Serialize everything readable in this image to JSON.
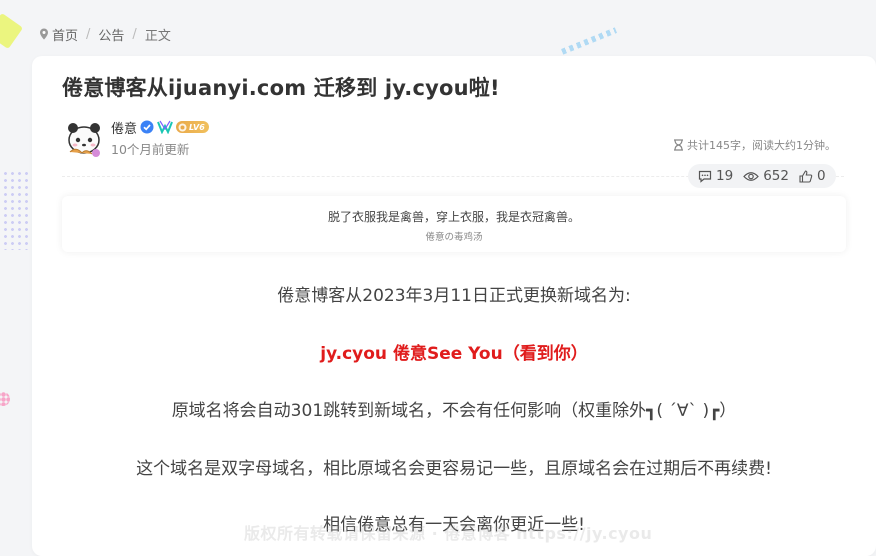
{
  "breadcrumb": {
    "items": [
      "首页",
      "公告",
      "正文"
    ],
    "separator": "/"
  },
  "post": {
    "title": "倦意博客从ijuanyi.com 迁移到 jy.cyou啦!",
    "author": {
      "name": "倦意",
      "level_badge": "LV6",
      "icons": [
        "verified-icon",
        "vip-icon"
      ],
      "updated": "10个月前更新"
    },
    "meta": "共计145字，阅读大约1分钟。",
    "stats": {
      "comments": "19",
      "views": "652",
      "likes": "0"
    },
    "quote": {
      "text": "脱了衣服我是禽兽，穿上衣服，我是衣冠禽兽。",
      "source": "倦意の毒鸡汤"
    },
    "paragraphs": [
      "倦意博客从2023年3月11日正式更换新域名为:",
      "jy.cyou   倦意See You（看到你）",
      "原域名将会自动301跳转到新域名，不会有任何影响（权重除外┓( ´∀` )┏）",
      "这个域名是双字母域名，相比原域名会更容易记一些，且原域名会在过期后不再续费!",
      "相信倦意总有一天会离你更近一些!"
    ],
    "watermark": "版权所有转载请保留来源 · 倦意博客 https://jy.cyou"
  },
  "colors": {
    "accent_red": "#e01c1c",
    "verified_blue": "#3b82f6",
    "level_gold": "#e9a94a"
  }
}
